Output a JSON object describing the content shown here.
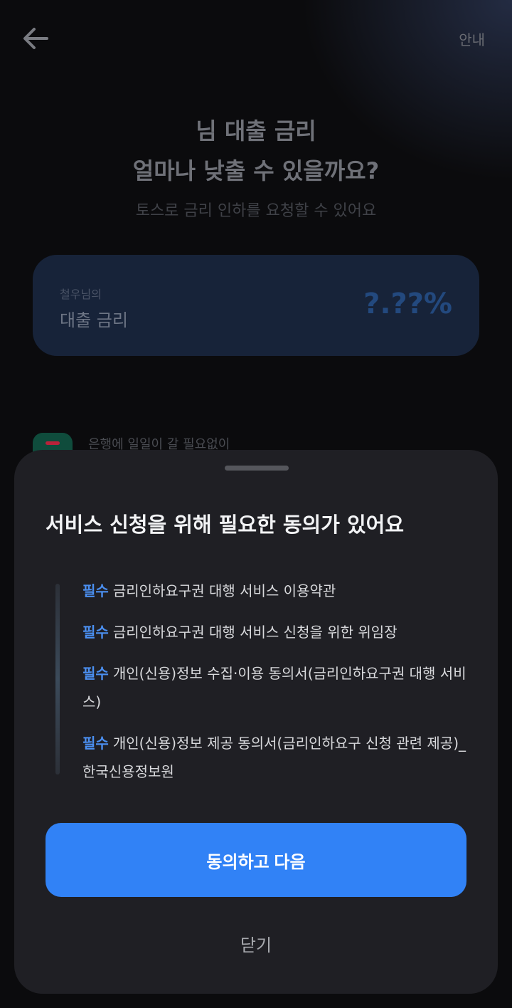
{
  "header": {
    "guide_label": "안내"
  },
  "hero": {
    "title_line1": "님 대출 금리",
    "title_line2": "얼마나 낮출 수 있을까요?",
    "subtitle": "토스로 금리 인하를 요청할 수 있어요"
  },
  "rate_card": {
    "owner_label": "철우님의",
    "label": "대출 금리",
    "value": "?.??%"
  },
  "bank_row": {
    "text": "은행에 일일이 갈 필요없이"
  },
  "sheet": {
    "title": "서비스 신청을 위해 필요한 동의가 있어요",
    "consents": [
      {
        "tag": "필수",
        "text": "금리인하요구권 대행 서비스 이용약관"
      },
      {
        "tag": "필수",
        "text": "금리인하요구권 대행 서비스 신청을 위한 위임장"
      },
      {
        "tag": "필수",
        "text": "개인(신용)정보 수집·이용 동의서(금리인하요구권 대행 서비스)"
      },
      {
        "tag": "필수",
        "text": "개인(신용)정보 제공 동의서(금리인하요구 신청 관련 제공)_한국신용정보원"
      }
    ],
    "agree_button": "동의하고 다음",
    "close_button": "닫기"
  },
  "colors": {
    "accent": "#3182f6",
    "required_tag": "#4b8ff0",
    "sheet_background": "#1f1f24"
  }
}
